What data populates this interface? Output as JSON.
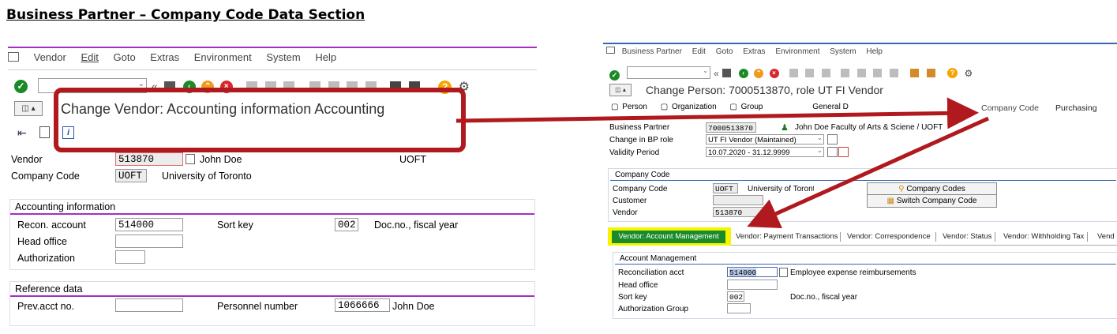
{
  "doc_title": "Business Partner – Company Code Data Section",
  "left": {
    "menu": [
      "Vendor",
      "Edit",
      "Goto",
      "Extras",
      "Environment",
      "System",
      "Help"
    ],
    "screen_title": "Change Vendor: Accounting information Accounting",
    "vendor_label": "Vendor",
    "vendor_value": "513870",
    "vendor_name": "John Doe",
    "vendor_org": "UOFT",
    "company_code_label": "Company Code",
    "company_code_value": "UOFT",
    "company_name": "University of Toronto",
    "accounting_title": "Accounting information",
    "recon_label": "Recon. account",
    "recon_value": "514000",
    "sort_key_label": "Sort key",
    "sort_key_value": "002",
    "sort_key_desc": "Doc.no., fiscal year",
    "head_office_label": "Head office",
    "authorization_label": "Authorization",
    "reference_title": "Reference data",
    "prev_acct_label": "Prev.acct no.",
    "personnel_label": "Personnel number",
    "personnel_value": "1066666",
    "personnel_name": "John Doe"
  },
  "right": {
    "menu": [
      "Business Partner",
      "Edit",
      "Goto",
      "Extras",
      "Environment",
      "System",
      "Help"
    ],
    "screen_title": "Change Person: 7000513870, role UT FI Vendor",
    "nav_tabs": [
      "Person",
      "Organization",
      "Group",
      "General D",
      "Company Code",
      "Purchasing"
    ],
    "bp_label": "Business Partner",
    "bp_value": "7000513870",
    "bp_desc": "John Doe Faculty of Arts & Sciene / UOFT",
    "role_label": "Change in BP role",
    "role_value": "UT FI Vendor (Maintained)",
    "validity_label": "Validity Period",
    "validity_value": "10.07.2020 - 31.12.9999",
    "cc_section_title": "Company Code",
    "cc_label": "Company Code",
    "cc_value": "UOFT",
    "cc_name": "University of Toronto",
    "customer_label": "Customer",
    "vendor_label": "Vendor",
    "vendor_value": "513870",
    "btn_company_codes": "Company Codes",
    "btn_switch": "Switch Company Code",
    "tabs": [
      "Vendor: Account Management",
      "Vendor: Payment Transactions",
      "Vendor: Correspondence",
      "Vendor: Status",
      "Vendor: Withholding Tax",
      "Vend"
    ],
    "account_mgmt_title": "Account Management",
    "recon_label": "Reconciliation acct",
    "recon_value": "514000",
    "recon_desc": "Employee expense reimbursements",
    "head_office_label": "Head office",
    "sort_key_label": "Sort key",
    "sort_key_value": "002",
    "sort_key_desc": "Doc.no., fiscal year",
    "auth_group_label": "Authorization Group"
  },
  "colors": {
    "annotation_red": "#b0191e",
    "tab_active_green": "#1a8a2a",
    "tab_highlight_yellow": "#f5f500",
    "sap_purple": "#a42ec8",
    "sap_blue": "#3a67b0"
  }
}
